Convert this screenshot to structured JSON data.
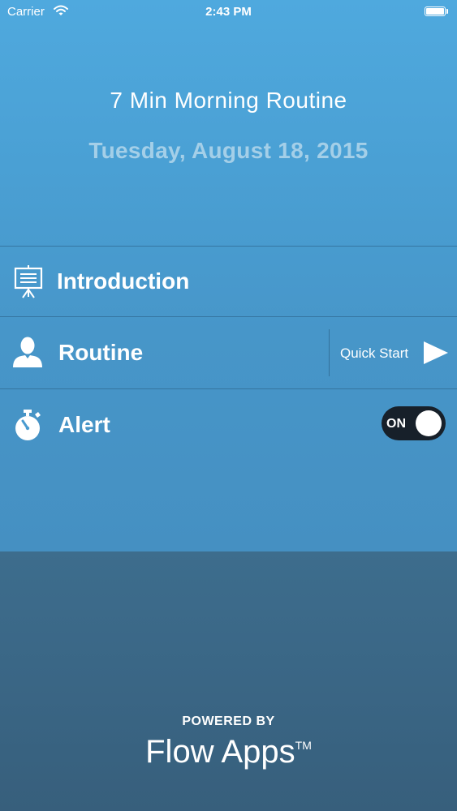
{
  "status_bar": {
    "carrier": "Carrier",
    "time": "2:43 PM",
    "icons": [
      "wifi-icon",
      "battery-icon"
    ]
  },
  "header": {
    "title": "7 Min Morning Routine",
    "date": "Tuesday, August 18, 2015"
  },
  "menu": {
    "introduction": {
      "label": "Introduction",
      "icon": "presentation-board-icon"
    },
    "routine": {
      "label": "Routine",
      "icon": "person-icon"
    },
    "quick_start": {
      "label": "Quick Start",
      "icon": "play-icon"
    },
    "alert": {
      "label": "Alert",
      "icon": "stopwatch-icon",
      "toggle_label": "ON",
      "toggle_state": true
    }
  },
  "footer": {
    "powered_by": "POWERED BY",
    "brand": "Flow Apps",
    "trademark": "TM"
  },
  "colors": {
    "top_background": "#4aa0d4",
    "bottom_background": "#3a6685",
    "date_text": "#a4cfe8",
    "toggle_track": "#17202a"
  }
}
